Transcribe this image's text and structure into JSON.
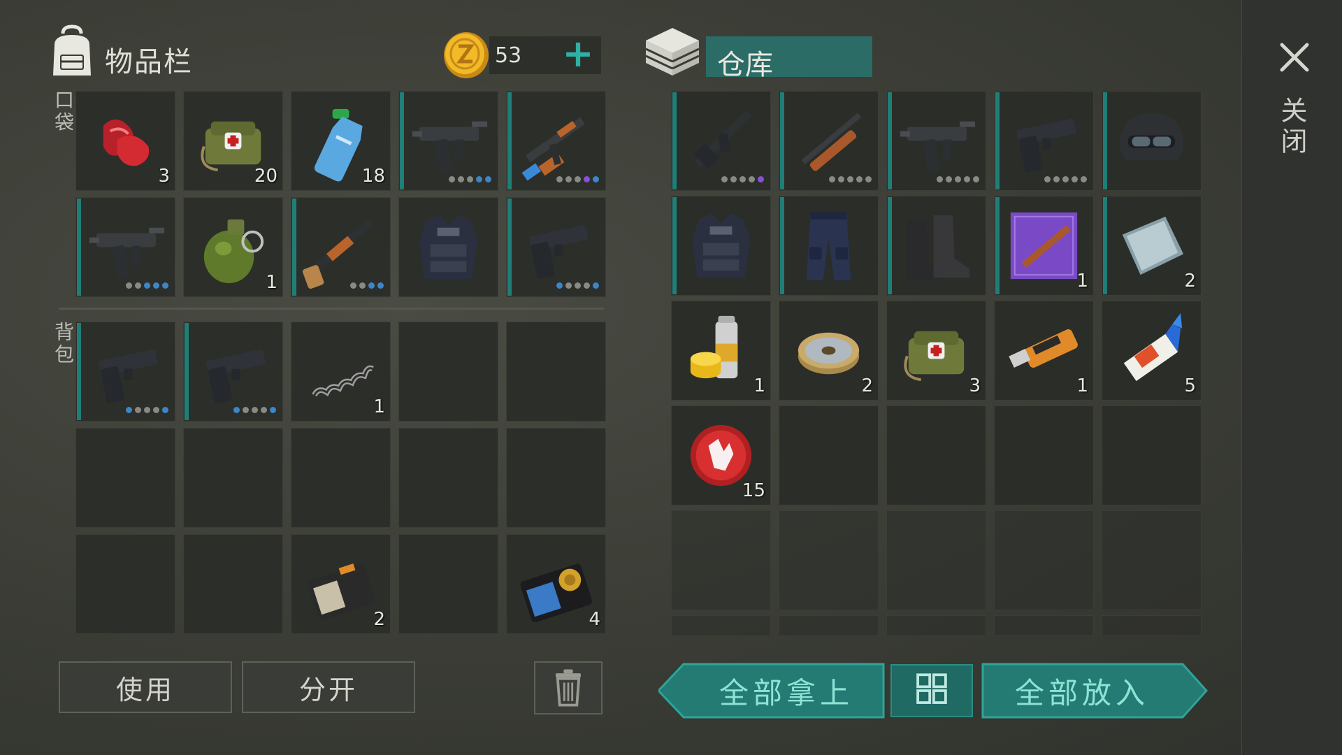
{
  "inventory": {
    "title": "物品栏",
    "currency": {
      "amount": "53",
      "plus": "+"
    },
    "pocket_label": "口袋",
    "bag_label": "背包",
    "pocket_slots": [
      {
        "item": "meat",
        "count": "3"
      },
      {
        "item": "medkit-bag",
        "count": "20"
      },
      {
        "item": "water-bottle",
        "count": "18"
      },
      {
        "item": "uzi",
        "quality": [
          "g",
          "g",
          "g",
          "b",
          "b"
        ]
      },
      {
        "item": "ak47",
        "quality": [
          "g",
          "g",
          "g",
          "p",
          "b"
        ]
      },
      {
        "item": "uzi",
        "quality": [
          "g",
          "g",
          "b",
          "b",
          "b"
        ]
      },
      {
        "item": "grenade",
        "count": "1"
      },
      {
        "item": "shotgun",
        "quality": [
          "g",
          "g",
          "b",
          "b"
        ]
      },
      {
        "item": "police-vest"
      },
      {
        "item": "pistol",
        "quality": [
          "b",
          "g",
          "g",
          "g",
          "b"
        ]
      }
    ],
    "bag_slots": [
      {
        "item": "pistol",
        "quality": [
          "b",
          "g",
          "g",
          "g",
          "b"
        ]
      },
      {
        "item": "pistol",
        "quality": [
          "b",
          "g",
          "g",
          "g",
          "b"
        ]
      },
      {
        "item": "spring",
        "count": "1"
      },
      {},
      {},
      {},
      {},
      {},
      {},
      {},
      {},
      {},
      {
        "item": "police-badge-wallet",
        "count": "2"
      },
      {},
      {
        "item": "badge-id",
        "count": "4"
      }
    ],
    "buttons": {
      "use": "使用",
      "split": "分开"
    }
  },
  "warehouse": {
    "title": "仓库",
    "slots": [
      {
        "item": "m16",
        "quality": [
          "g",
          "g",
          "g",
          "g",
          "p"
        ]
      },
      {
        "item": "rifle",
        "quality": [
          "g",
          "g",
          "g",
          "g",
          "g"
        ]
      },
      {
        "item": "uzi",
        "quality": [
          "g",
          "g",
          "g",
          "g",
          "g"
        ]
      },
      {
        "item": "pistol",
        "quality": [
          "g",
          "g",
          "g",
          "g",
          "g"
        ]
      },
      {
        "item": "helmet"
      },
      {
        "item": "police-vest"
      },
      {
        "item": "pants"
      },
      {
        "item": "boots"
      },
      {
        "item": "blueprint",
        "count": "1"
      },
      {
        "item": "metal-plate",
        "count": "2"
      },
      {
        "item": "spray-paint",
        "count": "1"
      },
      {
        "item": "wire-spool",
        "count": "2"
      },
      {
        "item": "medkit-bag",
        "count": "3"
      },
      {
        "item": "usb-drive",
        "count": "1"
      },
      {
        "item": "glue",
        "count": "5"
      },
      {
        "item": "bottle-cap",
        "count": "15"
      }
    ],
    "buttons": {
      "take_all": "全部拿上",
      "put_all": "全部放入"
    }
  },
  "close_label": "关闭",
  "colors": {
    "teal": "#237b73",
    "teal_text": "#8fe3d6",
    "bg": "#3a3d36"
  }
}
